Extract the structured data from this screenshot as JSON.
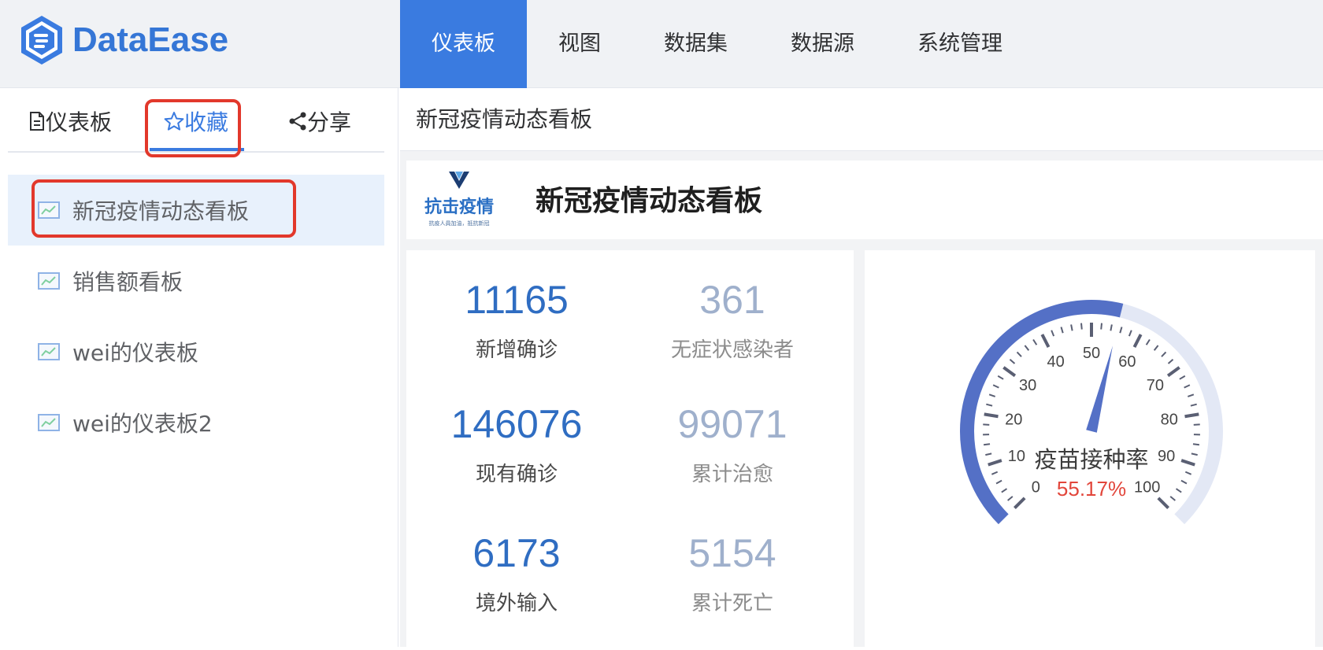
{
  "app": {
    "name": "DataEase"
  },
  "topnav": [
    {
      "label": "仪表板",
      "active": true
    },
    {
      "label": "视图",
      "active": false
    },
    {
      "label": "数据集",
      "active": false
    },
    {
      "label": "数据源",
      "active": false
    },
    {
      "label": "系统管理",
      "active": false
    }
  ],
  "sidebar": {
    "tabs": [
      {
        "label": "仪表板",
        "icon": "document-icon",
        "active": false
      },
      {
        "label": "收藏",
        "icon": "star-icon",
        "active": true
      },
      {
        "label": "分享",
        "icon": "share-icon",
        "active": false
      }
    ],
    "items": [
      {
        "label": "新冠疫情动态看板",
        "icon": "dashboard-icon",
        "active": true
      },
      {
        "label": "销售额看板",
        "icon": "dashboard-icon",
        "active": false
      },
      {
        "label": "wei的仪表板",
        "icon": "dashboard-icon",
        "active": false
      },
      {
        "label": "wei的仪表板2",
        "icon": "dashboard-icon",
        "active": false
      }
    ]
  },
  "main": {
    "title": "新冠疫情动态看板",
    "banner": {
      "logo_text": "抗击疫情",
      "logo_subtext": "抗疫人員加油，抵抗新冠",
      "title": "新冠疫情动态看板"
    },
    "stats": [
      {
        "value": "11165",
        "label": "新增确诊"
      },
      {
        "value": "361",
        "label": "无症状感染者"
      },
      {
        "value": "146076",
        "label": "现有确诊"
      },
      {
        "value": "99071",
        "label": "累计治愈"
      },
      {
        "value": "6173",
        "label": "境外输入"
      },
      {
        "value": "5154",
        "label": "累计死亡"
      }
    ],
    "gauge": {
      "label": "疫苗接种率",
      "value_text": "55.17%",
      "value": 55.17,
      "min": 0,
      "max": 100,
      "tick_labels": [
        "0",
        "10",
        "20",
        "30",
        "40",
        "50",
        "60",
        "70",
        "80",
        "90",
        "100"
      ]
    }
  },
  "colors": {
    "accent": "#3a7be0",
    "stat_primary": "#2f6dc2",
    "stat_secondary": "#9fb0cc",
    "gauge_fill": "#5470c6",
    "gauge_track": "#e3e8f5",
    "gauge_value": "#e2463b",
    "highlight_box": "#e2382b"
  }
}
